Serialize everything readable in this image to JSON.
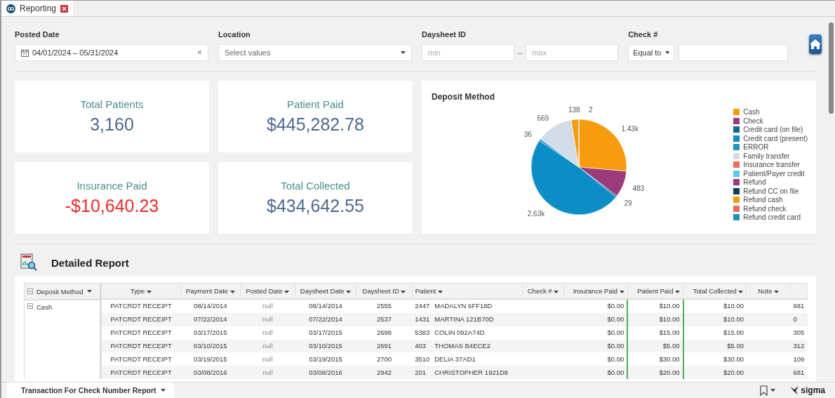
{
  "window": {
    "tab": {
      "label": "Reporting",
      "selected": true
    }
  },
  "filters": [
    {
      "kind": "date",
      "label": "Posted Date",
      "value": "04/01/2024 – 05/31/2024",
      "clear": "×"
    },
    {
      "kind": "select",
      "label": "Location",
      "placeholder": "Select values"
    },
    {
      "kind": "range",
      "label": "Daysheet ID",
      "min_placeholder": "min",
      "separator": "–",
      "max_placeholder": "max"
    },
    {
      "kind": "compare",
      "label": "Check #",
      "operator": "Equal to"
    }
  ],
  "kpis": [
    {
      "title": "Total Patients",
      "value": "3,160",
      "negative": false
    },
    {
      "title": "Patient Paid",
      "value": "$445,282.78",
      "negative": false
    },
    {
      "title": "Insurance Paid",
      "value": "-$10,640.23",
      "negative": true
    },
    {
      "title": "Total Collected",
      "value": "$434,642.55",
      "negative": false
    }
  ],
  "deposit_chart": {
    "chart_data": {
      "type": "pie",
      "title": "Deposit Method",
      "categories": [
        "Cash",
        "Check",
        "Credit card (on file)",
        "Credit card (present)",
        "ERROR",
        "Family transfer",
        "Insurance transfer",
        "Patient/Payer credit",
        "Refund",
        "Refund CC on file",
        "Refund cash",
        "Refund check",
        "Refund credit card"
      ],
      "legend": "right",
      "series": [
        {
          "colors": [
            "#f89c0e",
            "#9b3a7c",
            "#17698a",
            "#0b8ec6",
            "#1e93c4",
            "#d3dde8",
            "#e8705b",
            "#5ac8f0",
            "#9a3a7a",
            "#0d3f55",
            "#f39c12",
            "#e8705b",
            "#1a8fc8"
          ],
          "values": [
            26.4,
            8.92,
            0.54,
            48.54,
            0.66,
            12.35,
            0,
            0,
            0,
            0,
            2.55,
            0.04,
            0
          ]
        }
      ],
      "value_labels": [
        "1.43k",
        "483",
        "29",
        "2.63k",
        "36",
        "669",
        null,
        null,
        null,
        null,
        "138",
        "2",
        null
      ]
    }
  },
  "report": {
    "title": "Detailed Report",
    "group_column": "Deposit Method",
    "group": "Cash",
    "group_expanded": true,
    "columns": [
      "Type",
      "Payment Date",
      "Posted Date",
      "Daysheet Date",
      "Daysheet ID",
      "Patient",
      "Check #",
      "Insurance Paid",
      "Patient Paid",
      "Total Collected",
      "Note"
    ],
    "rows": [
      {
        "type": "PATCRDT RECEIPT",
        "payment_date": "08/14/2014",
        "posted_date": "null",
        "daysheet_date": "08/14/2014",
        "daysheet_id": "2555",
        "patient_id": "2447",
        "patient": "MADALYN 6FF18D",
        "insurance_paid": "$0.00",
        "patient_paid": "$10.00",
        "total_collected": "$10.00",
        "column_12": "681"
      },
      {
        "type": "PATCRDT RECEIPT",
        "payment_date": "07/22/2014",
        "posted_date": "null",
        "daysheet_date": "07/22/2014",
        "daysheet_id": "2537",
        "patient_id": "1431",
        "patient": "MARTINA 121B70D",
        "insurance_paid": "$0.00",
        "patient_paid": "$10.00",
        "total_collected": "$10.00",
        "column_12": "0"
      },
      {
        "type": "PATCRDT RECEIPT",
        "payment_date": "03/17/2015",
        "posted_date": "null",
        "daysheet_date": "03/17/2015",
        "daysheet_id": "2698",
        "patient_id": "5383",
        "patient": "COLIN 092A74D",
        "insurance_paid": "$0.00",
        "patient_paid": "$15.00",
        "total_collected": "$15.00",
        "column_12": "305"
      },
      {
        "type": "PATCRDT RECEIPT",
        "payment_date": "03/10/2015",
        "posted_date": "null",
        "daysheet_date": "03/10/2015",
        "daysheet_id": "2691",
        "patient_id": "403",
        "patient": "THOMAS B4ECE2",
        "insurance_paid": "$0.00",
        "patient_paid": "$5.00",
        "total_collected": "$5.00",
        "column_12": "312"
      },
      {
        "type": "PATCRDT RECEIPT",
        "payment_date": "03/19/2015",
        "posted_date": "null",
        "daysheet_date": "03/19/2015",
        "daysheet_id": "2700",
        "patient_id": "3510",
        "patient": "DELIA 37AD1",
        "insurance_paid": "$0.00",
        "patient_paid": "$30.00",
        "total_collected": "$30.00",
        "column_12": "109"
      },
      {
        "type": "PATCRDT RECEIPT",
        "payment_date": "03/08/2016",
        "posted_date": "null",
        "daysheet_date": "03/08/2016",
        "daysheet_id": "2942",
        "patient_id": "201",
        "patient": "CHRISTOPHER 1921D8",
        "insurance_paid": "$0.00",
        "patient_paid": "$20.00",
        "total_collected": "$20.00",
        "column_12": "681"
      }
    ]
  },
  "status_bar": {
    "page_tab": "Transaction For Check Number Report",
    "brand": "sigma"
  }
}
